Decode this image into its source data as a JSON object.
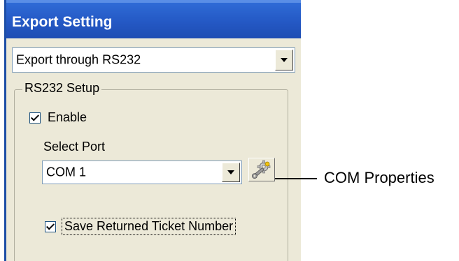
{
  "panel": {
    "title": "Export Setting",
    "export_method": {
      "selected": "Export through RS232"
    },
    "rs232_group": {
      "legend": "RS232 Setup",
      "enable": {
        "label": "Enable",
        "checked": true
      },
      "select_port": {
        "label": "Select Port",
        "selected": "COM 1"
      },
      "com_properties_icon": "gear-wrench-icon",
      "save_ticket": {
        "label": "Save Returned Ticket Number",
        "checked": true
      }
    }
  },
  "callout": {
    "text": "COM Properties"
  },
  "colors": {
    "header_blue": "#2458c4",
    "panel_bg": "#ece9d8",
    "border_blue": "#7f9db9"
  }
}
